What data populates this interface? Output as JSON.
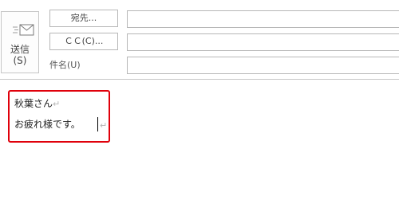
{
  "send_button": {
    "label": "送信\n(S)",
    "icon": "send-envelope-icon"
  },
  "header": {
    "to_button": "宛先...",
    "cc_button": "ＣＣ(C)...",
    "subject_label": "件名(U)",
    "to_value": "",
    "cc_value": "",
    "subject_value": ""
  },
  "body": {
    "line1": "秋葉さん",
    "line2": "お疲れ様です。",
    "paragraph_mark": "↵"
  },
  "colors": {
    "highlight": "#e0000b",
    "border": "#b7b7b7"
  }
}
